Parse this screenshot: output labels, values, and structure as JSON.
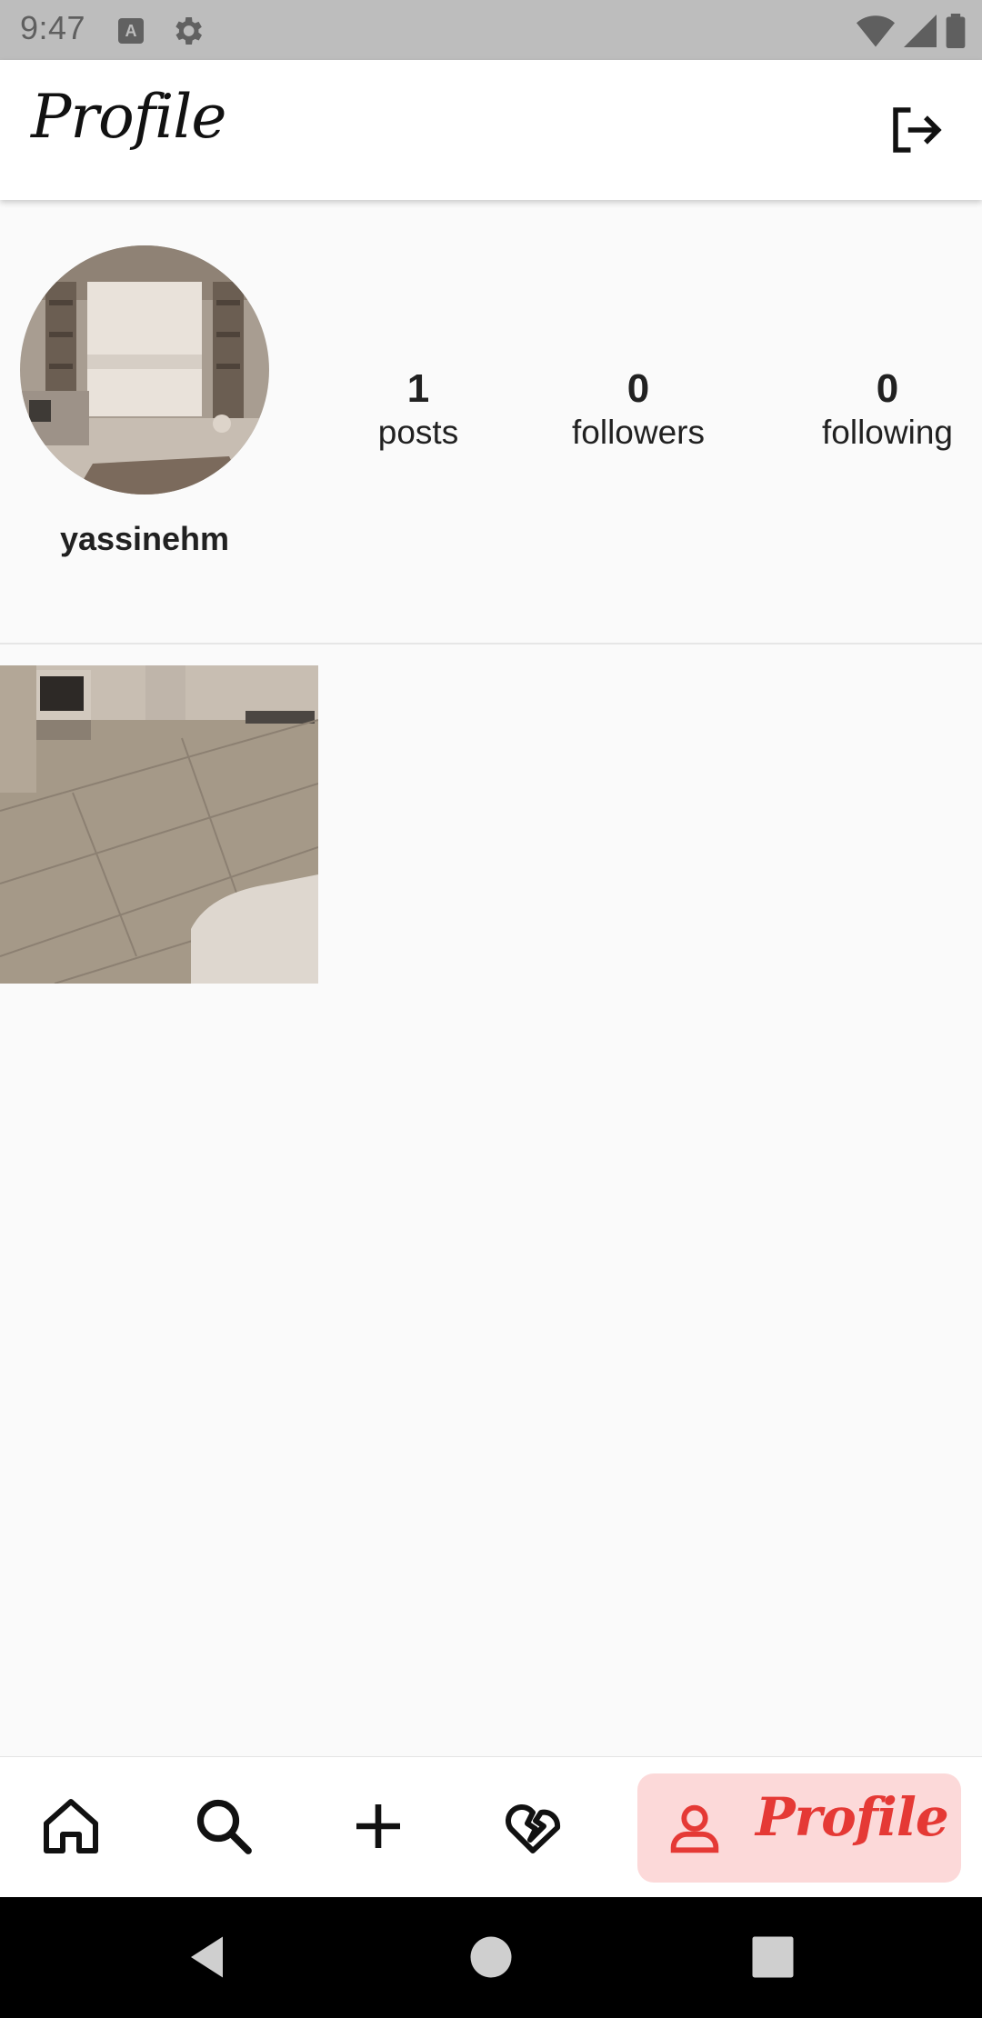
{
  "status_bar": {
    "time": "9:47",
    "icons": [
      "a-notification-icon",
      "settings-icon",
      "wifi-icon",
      "signal-icon",
      "battery-icon"
    ]
  },
  "header": {
    "title": "Profile",
    "logout_icon": "logout-icon"
  },
  "profile": {
    "username": "yassinehm",
    "stats": [
      {
        "count": "1",
        "label": "posts"
      },
      {
        "count": "0",
        "label": "followers"
      },
      {
        "count": "0",
        "label": "following"
      }
    ]
  },
  "posts": [
    {
      "kind": "image",
      "subject": "room-floor-photo"
    }
  ],
  "bottom_nav": {
    "items": [
      {
        "icon": "home-icon"
      },
      {
        "icon": "search-icon"
      },
      {
        "icon": "add-icon"
      },
      {
        "icon": "broken-heart-icon"
      },
      {
        "icon": "person-icon",
        "label": "Profile",
        "active": true
      }
    ],
    "active_color": "#e53935",
    "active_bg": "#fcd9d9"
  },
  "system_nav": {
    "buttons": [
      "back-icon",
      "home-circle-icon",
      "recents-icon"
    ]
  }
}
